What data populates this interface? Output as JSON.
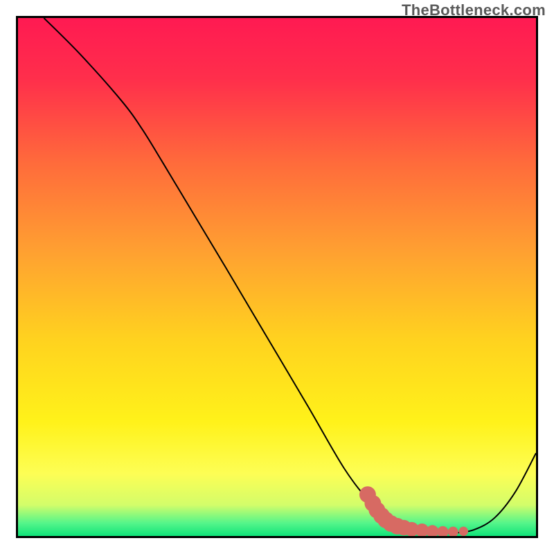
{
  "watermark": "TheBottleneck.com",
  "colors": {
    "frame": "#000000",
    "curve": "#000000",
    "marker": "#d76a63",
    "gradient_stops": [
      {
        "offset": 0.0,
        "color": "#ff1a52"
      },
      {
        "offset": 0.12,
        "color": "#ff2f4b"
      },
      {
        "offset": 0.28,
        "color": "#ff6b3b"
      },
      {
        "offset": 0.45,
        "color": "#ffa031"
      },
      {
        "offset": 0.62,
        "color": "#ffd21f"
      },
      {
        "offset": 0.78,
        "color": "#fff21a"
      },
      {
        "offset": 0.88,
        "color": "#fdfe55"
      },
      {
        "offset": 0.94,
        "color": "#d3fd6a"
      },
      {
        "offset": 0.975,
        "color": "#55f58a"
      },
      {
        "offset": 1.0,
        "color": "#10e47a"
      }
    ]
  },
  "chart_data": {
    "type": "line",
    "title": "",
    "xlabel": "",
    "ylabel": "",
    "xlim": [
      0,
      100
    ],
    "ylim": [
      0,
      100
    ],
    "grid": false,
    "series": [
      {
        "name": "bottleneck-curve",
        "x": [
          5,
          12,
          20,
          24,
          28,
          34,
          40,
          48,
          56,
          63,
          68,
          72,
          76,
          80,
          84,
          88,
          92,
          96,
          100
        ],
        "y": [
          100,
          93,
          84,
          78.5,
          72,
          62,
          52,
          38.5,
          25,
          13,
          6.5,
          3,
          1.4,
          0.8,
          0.6,
          1.2,
          3.5,
          8.5,
          16
        ]
      }
    ],
    "markers": [
      {
        "name": "highlight-region",
        "points": [
          {
            "x": 67.5,
            "y": 8.0,
            "r": 1.6
          },
          {
            "x": 68.5,
            "y": 6.3,
            "r": 1.6
          },
          {
            "x": 69.3,
            "y": 5.0,
            "r": 1.6
          },
          {
            "x": 70.2,
            "y": 3.9,
            "r": 1.6
          },
          {
            "x": 71.0,
            "y": 3.1,
            "r": 1.6
          },
          {
            "x": 72.0,
            "y": 2.4,
            "r": 1.6
          },
          {
            "x": 73.2,
            "y": 1.9,
            "r": 1.6
          },
          {
            "x": 74.5,
            "y": 1.6,
            "r": 1.5
          },
          {
            "x": 76.0,
            "y": 1.3,
            "r": 1.4
          },
          {
            "x": 78.0,
            "y": 1.1,
            "r": 1.3
          },
          {
            "x": 80.0,
            "y": 0.9,
            "r": 1.2
          },
          {
            "x": 82.0,
            "y": 0.8,
            "r": 1.1
          },
          {
            "x": 84.0,
            "y": 0.8,
            "r": 1.0
          },
          {
            "x": 86.0,
            "y": 0.9,
            "r": 0.9
          }
        ]
      }
    ]
  }
}
